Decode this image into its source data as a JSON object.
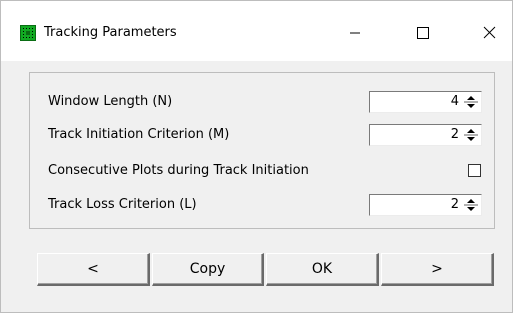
{
  "window": {
    "title": "Tracking Parameters"
  },
  "params": [
    {
      "label": "Window Length (N)",
      "value": "4"
    },
    {
      "label": "Track Initiation Criterion (M)",
      "value": "2"
    },
    {
      "label": "Consecutive Plots during Track Initiation",
      "checked": false
    },
    {
      "label": "Track Loss Criterion (L)",
      "value": "2"
    }
  ],
  "buttons": {
    "prev": "<",
    "copy": "Copy",
    "ok": "OK",
    "next": ">"
  },
  "colors": {
    "app_icon": "#11aa22",
    "background": "#f0f0f0"
  },
  "icons": {
    "app": "tracking-grid-icon",
    "minimize": "minimize-icon",
    "maximize": "maximize-icon",
    "close": "close-icon"
  }
}
